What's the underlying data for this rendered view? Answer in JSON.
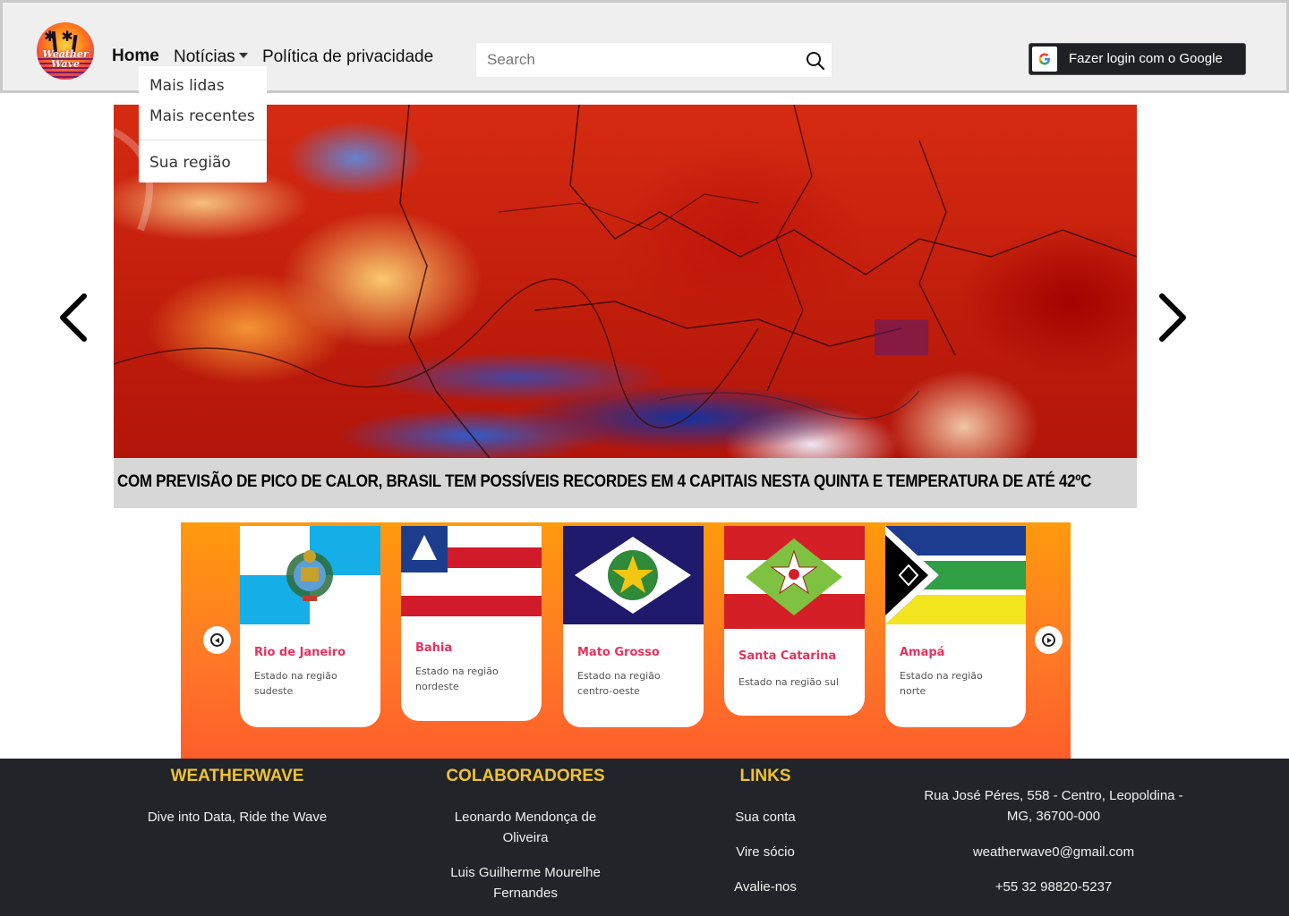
{
  "brand": {
    "logo_text": "Weather Wave"
  },
  "nav": {
    "home": "Home",
    "news": "Notícias",
    "privacy": "Política de privacidade",
    "dropdown": [
      "Mais lidas",
      "Mais recentes",
      "Sua região"
    ]
  },
  "search": {
    "placeholder": "Search"
  },
  "login": {
    "label": "Fazer login com o Google"
  },
  "carousel": {
    "caption": "COM PREVISÃO DE PICO DE CALOR, BRASIL TEM POSSÍVEIS RECORDES EM 4 CAPITAIS NESTA QUINTA E TEMPERATURA DE ATÉ 42ºC"
  },
  "states": [
    {
      "name": "Rio de Janeiro",
      "desc": "Estado na região sudeste"
    },
    {
      "name": "Bahia",
      "desc": "Estado na região nordeste"
    },
    {
      "name": "Mato Grosso",
      "desc": "Estado na região centro-oeste"
    },
    {
      "name": "Santa Catarina",
      "desc": "Estado na região sul"
    },
    {
      "name": "Amapá",
      "desc": "Estado na região norte"
    }
  ],
  "footer": {
    "about": {
      "title": "WEATHERWAVE",
      "tagline": "Dive into Data, Ride the Wave"
    },
    "collaborators": {
      "title": "COLABORADORES",
      "names": [
        "Leonardo Mendonça de Oliveira",
        "Luis Guilherme Mourelhe Fernandes"
      ]
    },
    "links": {
      "title": "LINKS",
      "items": [
        "Sua conta",
        "Vire sócio",
        "Avalie-nos"
      ]
    },
    "contact": {
      "address": "Rua José Péres, 558 - Centro, Leopoldina - MG, 36700-000",
      "email": "weatherwave0@gmail.com",
      "phone": "+55 32 98820-5237"
    }
  },
  "colors": {
    "accent_pink": "#e8315d",
    "footer_title": "#f1c232",
    "footer_bg": "#212529",
    "strip_orange": "#ff8a1c"
  }
}
